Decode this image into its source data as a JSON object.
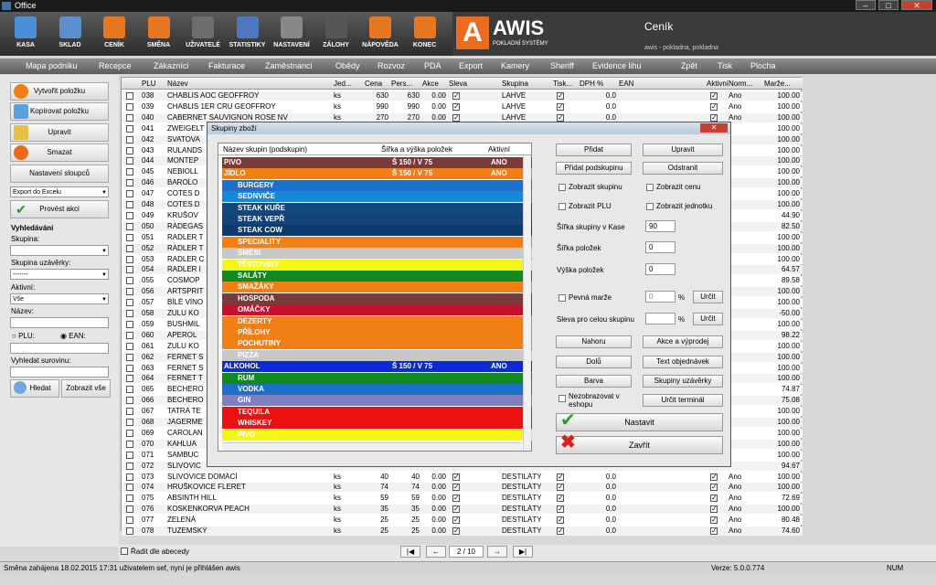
{
  "window": {
    "title": "Office"
  },
  "toolbar": [
    {
      "label": "KASA",
      "color": "#4a90d9"
    },
    {
      "label": "SKLAD",
      "color": "#5b8fd0"
    },
    {
      "label": "CENÍK",
      "color": "#e87722"
    },
    {
      "label": "SMĚNA",
      "color": "#e87722"
    },
    {
      "label": "UŽIVATELÉ",
      "color": "#6d6d6d"
    },
    {
      "label": "STATISTIKY",
      "color": "#4b78c0"
    },
    {
      "label": "NASTAVENÍ",
      "color": "#888888"
    },
    {
      "label": "ZÁLOHY",
      "color": "#555555"
    },
    {
      "label": "NÁPOVĚDA",
      "color": "#e87722"
    },
    {
      "label": "KONEC",
      "color": "#e87722"
    }
  ],
  "logo": {
    "brand": "AWIS",
    "tagline": "POKLADNÍ SYSTÉMY",
    "page_title": "Ceník",
    "page_subtitle": "awis - pokladna, pokladna"
  },
  "menu": [
    "Mapa podniku",
    "Recepce",
    "Zákazníci",
    "Fakturace",
    "Zaměstnanci",
    "Obědy",
    "Rozvoz",
    "PDA",
    "Export",
    "Kamery",
    "Sheriff",
    "Evidence lihu",
    "Zpět",
    "Tisk",
    "Plocha"
  ],
  "sidebar": {
    "buttons": [
      "Vytvořit položku",
      "Kopírovat položku",
      "Upravit",
      "Smazat",
      "Nastavení sloupců"
    ],
    "export_select": "Export do Excelu",
    "do_action": "Provést akci",
    "search_heading": "Vyhledávání",
    "group_label": "Skupina:",
    "group_value": "",
    "close_group_label": "Skupina uzávěrky:",
    "close_group_value": "-------",
    "active_label": "Aktivní:",
    "active_value": "Vše",
    "name_label": "Název:",
    "plu_label": "PLU:",
    "ean_label": "EAN:",
    "ingredient_label": "Vyhledat surovinu:",
    "search_btn": "Hledat",
    "show_all_btn": "Zobrazit vše"
  },
  "grid": {
    "columns": [
      "PLU",
      "Název",
      "Jed...",
      "Cena",
      "Pers...",
      "Akce",
      "Sleva",
      "Skupina",
      "Tisk...",
      "DPH %",
      "EAN",
      "Aktivní",
      "Norm...",
      "Marže..."
    ],
    "rows": [
      [
        "038",
        "CHABLIS AOC  GEOFFROY",
        "ks",
        "630",
        "630",
        "0.00",
        "x",
        "LAHVE",
        "x",
        "0.0",
        "",
        "x",
        "Ano",
        "100.00"
      ],
      [
        "039",
        "CHABLIS 1ER CRU GEOFFROY",
        "ks",
        "990",
        "990",
        "0.00",
        "x",
        "LAHVE",
        "x",
        "0.0",
        "",
        "x",
        "Ano",
        "100.00"
      ],
      [
        "040",
        "CABERNET SAUVIGNON ROSE NV",
        "ks",
        "270",
        "270",
        "0.00",
        "x",
        "LAHVE",
        "x",
        "0.0",
        "",
        "x",
        "Ano",
        "100.00"
      ],
      [
        "041",
        "ZWEIGELT",
        "",
        "",
        "",
        "",
        "",
        "",
        "",
        "",
        "",
        "",
        "",
        "100.00"
      ],
      [
        "042",
        "SVATOVA",
        "",
        "",
        "",
        "",
        "",
        "",
        "",
        "",
        "",
        "",
        "",
        "100.00"
      ],
      [
        "043",
        "RULANDS",
        "",
        "",
        "",
        "",
        "",
        "",
        "",
        "",
        "",
        "",
        "",
        "100.00"
      ],
      [
        "044",
        "MONTEP",
        "",
        "",
        "",
        "",
        "",
        "",
        "",
        "",
        "",
        "",
        "",
        "100.00"
      ],
      [
        "045",
        "NEBIOLL",
        "",
        "",
        "",
        "",
        "",
        "",
        "",
        "",
        "",
        "",
        "",
        "100.00"
      ],
      [
        "046",
        "BAROLO",
        "",
        "",
        "",
        "",
        "",
        "",
        "",
        "",
        "",
        "",
        "",
        "100.00"
      ],
      [
        "047",
        "COTES D",
        "",
        "",
        "",
        "",
        "",
        "",
        "",
        "",
        "",
        "",
        "",
        "100.00"
      ],
      [
        "048",
        "COTES D",
        "",
        "",
        "",
        "",
        "",
        "",
        "",
        "",
        "",
        "",
        "",
        "100.00"
      ],
      [
        "049",
        "KRUŠOV",
        "",
        "",
        "",
        "",
        "",
        "",
        "",
        "",
        "",
        "",
        "",
        "44.90"
      ],
      [
        "050",
        "RADEGAS",
        "",
        "",
        "",
        "",
        "",
        "",
        "",
        "",
        "",
        "",
        "",
        "82.50"
      ],
      [
        "051",
        "RADLER T",
        "",
        "",
        "",
        "",
        "",
        "",
        "",
        "",
        "",
        "",
        "",
        "100.00"
      ],
      [
        "052",
        "RADLER T",
        "",
        "",
        "",
        "",
        "",
        "",
        "",
        "",
        "",
        "",
        "",
        "100.00"
      ],
      [
        "053",
        "RADLER C",
        "",
        "",
        "",
        "",
        "",
        "",
        "",
        "",
        "",
        "",
        "",
        "100.00"
      ],
      [
        "054",
        "RADLER I",
        "",
        "",
        "",
        "",
        "",
        "",
        "",
        "",
        "",
        "",
        "",
        "64.57"
      ],
      [
        "055",
        "COSMOP",
        "",
        "",
        "",
        "",
        "",
        "",
        "",
        "",
        "",
        "",
        "",
        "89.58"
      ],
      [
        "056",
        "ARTSPRIT",
        "",
        "",
        "",
        "",
        "",
        "",
        "",
        "",
        "",
        "",
        "",
        "100.00"
      ],
      [
        "057",
        "BÍLÉ VÍNO",
        "",
        "",
        "",
        "",
        "",
        "",
        "",
        "",
        "",
        "",
        "",
        "100.00"
      ],
      [
        "058",
        "ZULU KO",
        "",
        "",
        "",
        "",
        "",
        "",
        "",
        "",
        "",
        "",
        "",
        "-50.00"
      ],
      [
        "059",
        "BUSHMIL",
        "",
        "",
        "",
        "",
        "",
        "",
        "",
        "",
        "",
        "",
        "",
        "100.00"
      ],
      [
        "060",
        "APEROL",
        "",
        "",
        "",
        "",
        "",
        "",
        "",
        "",
        "",
        "",
        "",
        "98.22"
      ],
      [
        "061",
        "ZULU KO",
        "",
        "",
        "",
        "",
        "",
        "",
        "",
        "",
        "",
        "",
        "",
        "100.00"
      ],
      [
        "062",
        "FERNET S",
        "",
        "",
        "",
        "",
        "",
        "",
        "",
        "",
        "",
        "",
        "",
        "100.00"
      ],
      [
        "063",
        "FERNET S",
        "",
        "",
        "",
        "",
        "",
        "",
        "",
        "",
        "",
        "",
        "",
        "100.00"
      ],
      [
        "064",
        "FERNET T",
        "",
        "",
        "",
        "",
        "",
        "",
        "",
        "",
        "",
        "",
        "",
        "100.00"
      ],
      [
        "065",
        "BECHERO",
        "",
        "",
        "",
        "",
        "",
        "",
        "",
        "",
        "",
        "",
        "",
        "74.87"
      ],
      [
        "066",
        "BECHERO",
        "",
        "",
        "",
        "",
        "",
        "",
        "",
        "",
        "",
        "",
        "",
        "75.08"
      ],
      [
        "067",
        "TATRA TE",
        "",
        "",
        "",
        "",
        "",
        "",
        "",
        "",
        "",
        "",
        "",
        "100.00"
      ],
      [
        "068",
        "JAGERME",
        "",
        "",
        "",
        "",
        "",
        "",
        "",
        "",
        "",
        "",
        "",
        "100.00"
      ],
      [
        "069",
        "CAROLAN",
        "",
        "",
        "",
        "",
        "",
        "",
        "",
        "",
        "",
        "",
        "",
        "100.00"
      ],
      [
        "070",
        "KAHLUA",
        "",
        "",
        "",
        "",
        "",
        "",
        "",
        "",
        "",
        "",
        "",
        "100.00"
      ],
      [
        "071",
        "SAMBUC",
        "",
        "",
        "",
        "",
        "",
        "",
        "",
        "",
        "",
        "",
        "",
        "100.00"
      ],
      [
        "072",
        "SLIVOVIC",
        "",
        "",
        "",
        "",
        "",
        "",
        "",
        "",
        "",
        "",
        "",
        "94.67"
      ],
      [
        "073",
        "SLIVOVICE DOMÁCÍ",
        "ks",
        "40",
        "40",
        "0.00",
        "x",
        "DESTILÁTY",
        "x",
        "0.0",
        "",
        "x",
        "Ano",
        "100.00"
      ],
      [
        "074",
        "HRUŠKOVICE FLERET",
        "ks",
        "74",
        "74",
        "0.00",
        "x",
        "DESTILÁTY",
        "x",
        "0.0",
        "",
        "x",
        "Ano",
        "100.00"
      ],
      [
        "075",
        "ABSINTH HILL",
        "ks",
        "59",
        "59",
        "0.00",
        "x",
        "DESTILÁTY",
        "x",
        "0.0",
        "",
        "x",
        "Ano",
        "72.69"
      ],
      [
        "076",
        "KOSKENKORVA PEACH",
        "ks",
        "35",
        "35",
        "0.00",
        "x",
        "DESTILÁTY",
        "x",
        "0.0",
        "",
        "x",
        "Ano",
        "100.00"
      ],
      [
        "077",
        "ZELENÁ",
        "ks",
        "25",
        "25",
        "0.00",
        "x",
        "DESTILÁTY",
        "x",
        "0.0",
        "",
        "x",
        "Ano",
        "80.48"
      ],
      [
        "078",
        "TUZEMSKÝ",
        "ks",
        "25",
        "25",
        "0.00",
        "x",
        "DESTILÁTY",
        "x",
        "0.0",
        "",
        "x",
        "Ano",
        "74.60"
      ]
    ]
  },
  "bottom": {
    "sort_label": "Řadit dle abecedy",
    "page": "2 / 10"
  },
  "status": {
    "left": "Směna zahájena 18.02.2015 17:31 uživatelem sef, nyní je přihlášen awis",
    "version": "Verze: 5.0.0.774",
    "num": "NUM"
  },
  "dialog": {
    "title": "Skupiny zboží",
    "list_headers": [
      "Název skupin (podskupin)",
      "Šířka a výška položek",
      "Aktivní"
    ],
    "groups": [
      {
        "name": "PIVO",
        "size": "Š 150 / V 75",
        "active": "ANO",
        "color": "#7b3b3b",
        "sub": false
      },
      {
        "name": "JÍDLO",
        "size": "Š 150 / V 75",
        "active": "ANO",
        "color": "#f07f16",
        "sub": false
      },
      {
        "name": "BURGERY",
        "color": "#1e6fc9",
        "sub": true
      },
      {
        "name": "SEDNVIČE",
        "color": "#1889d8",
        "sub": true
      },
      {
        "name": "STEAK KUŘE",
        "color": "#14477e",
        "sub": true
      },
      {
        "name": "STEAK VEPŘ",
        "color": "#13437a",
        "sub": true
      },
      {
        "name": "STEAK COW",
        "color": "#0c3a6c",
        "sub": true
      },
      {
        "name": "SPECIALITY",
        "color": "#f07f16",
        "sub": true
      },
      {
        "name": "SMĚSI",
        "color": "#c8c8c8",
        "sub": true
      },
      {
        "name": "TĚSTOVINY",
        "color": "#f6f614",
        "sub": true
      },
      {
        "name": "SALÁTY",
        "color": "#10891e",
        "sub": true
      },
      {
        "name": "SMAŽÁKY",
        "color": "#f07f16",
        "sub": true
      },
      {
        "name": "HOSPODA",
        "color": "#7b3b3b",
        "sub": true
      },
      {
        "name": "OMÁČKY",
        "color": "#c8102e",
        "sub": true
      },
      {
        "name": "DEZERTY",
        "color": "#f07f16",
        "sub": true
      },
      {
        "name": "PŘÍLOHY",
        "color": "#f07f16",
        "sub": true
      },
      {
        "name": "POCHUTINY",
        "color": "#f07f16",
        "sub": true
      },
      {
        "name": "PIZZA",
        "color": "#c8c8c8",
        "sub": true
      },
      {
        "name": "ALKOHOL",
        "size": "Š 150 / V 75",
        "active": "ANO",
        "color": "#0a2ad8",
        "sub": false
      },
      {
        "name": "RUM",
        "color": "#10891e",
        "sub": true
      },
      {
        "name": "VODKA",
        "color": "#1e6fc9",
        "sub": true
      },
      {
        "name": "GIN",
        "color": "#8080c0",
        "sub": true
      },
      {
        "name": "TEQUILA",
        "color": "#ee1010",
        "sub": true
      },
      {
        "name": "WHISKEY",
        "color": "#ee1010",
        "sub": true
      },
      {
        "name": "PIVO",
        "color": "#f6f614",
        "sub": true
      }
    ],
    "buttons": {
      "add": "Přidat",
      "edit": "Upravit",
      "add_sub": "Přidat podskupinu",
      "remove": "Odstranit",
      "up": "Nahoru",
      "promo": "Akce a výprodej",
      "down": "Dolů",
      "text_order": "Text objednávek",
      "color": "Barva",
      "close_groups": "Skupiny uzávěrky",
      "terminal": "Určit terminál",
      "set": "Určit",
      "set2": "Určit",
      "confirm": "Nastavit",
      "close": "Zavřít"
    },
    "checks": {
      "show_groups": "Zobrazit skupinu",
      "show_price": "Zobrazit cenu",
      "show_plu": "Zobrazit PLU",
      "show_unit": "Zobrazit jednotku",
      "fixed_margin": "Pevná marže",
      "hide_eshop": "Nezobrazovat v eshopu"
    },
    "fields": {
      "width_label": "Šířka skupiny v Kase",
      "width_value": "90",
      "item_width_label": "Šířka položek",
      "item_width_value": "0",
      "item_height_label": "Výška položek",
      "item_height_value": "0",
      "margin_value": "0",
      "discount_label": "Sleva pro celou skupinu",
      "discount_value": "",
      "pct": "%",
      "pct2": "%"
    }
  }
}
